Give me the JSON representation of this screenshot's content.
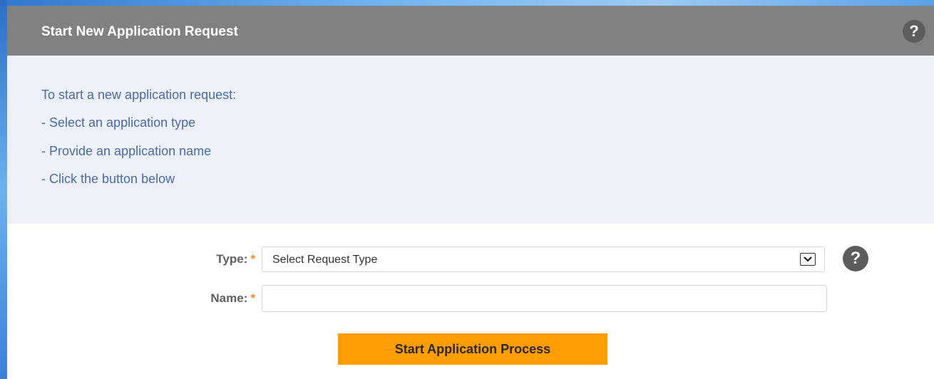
{
  "panel": {
    "title": "Start New Application Request",
    "help_label": "?"
  },
  "instructions": {
    "lines": [
      "To start a new application request:",
      "- Select an application type",
      "- Provide an application name",
      "- Click the button below"
    ]
  },
  "form": {
    "type_label": "Type:",
    "name_label": "Name:",
    "required_marker": "*",
    "type_select": {
      "selected": "Select Request Type"
    },
    "type_help_label": "?",
    "name_input": {
      "value": "",
      "placeholder": ""
    },
    "submit_label": "Start Application Process"
  },
  "colors": {
    "header_bg": "#7f8280",
    "instructions_bg": "#edf0f8",
    "instructions_text": "#4a6ba8",
    "required_marker": "#f08c1e",
    "submit_bg": "#ff9d00"
  }
}
